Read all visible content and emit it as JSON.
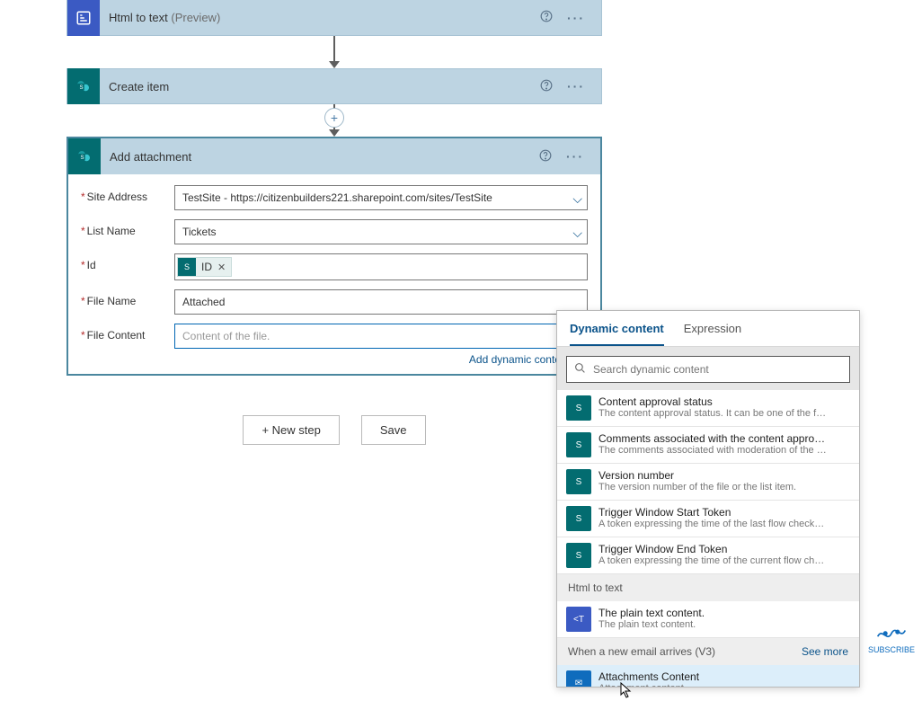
{
  "actions": {
    "htmlToText": {
      "label": "Html to text",
      "suffix": "(Preview)"
    },
    "createItem": {
      "label": "Create item"
    },
    "addAttachment": {
      "label": "Add attachment"
    }
  },
  "form": {
    "siteAddress": {
      "label": "Site Address",
      "value": "TestSite - https://citizenbuilders221.sharepoint.com/sites/TestSite"
    },
    "listName": {
      "label": "List Name",
      "value": "Tickets"
    },
    "id": {
      "label": "Id",
      "tokenLabel": "ID"
    },
    "fileName": {
      "label": "File Name",
      "value": "Attached"
    },
    "fileContent": {
      "label": "File Content",
      "placeholder": "Content of the file."
    },
    "addDynamic": "Add dynamic content"
  },
  "buttons": {
    "newStep": "+ New step",
    "save": "Save"
  },
  "popup": {
    "tabs": {
      "dynamic": "Dynamic content",
      "expression": "Expression"
    },
    "searchPlaceholder": "Search dynamic content",
    "groups": {
      "htmlToText": "Html to text",
      "emailV3": "When a new email arrives (V3)",
      "seeMore": "See more"
    },
    "items": [
      {
        "icon": "sp",
        "title": "Content approval status",
        "sub": "The content approval status. It can be one of the followin..."
      },
      {
        "icon": "sp",
        "title": "Comments associated with the content approval of this ...",
        "sub": "The comments associated with moderation of the list item."
      },
      {
        "icon": "sp",
        "title": "Version number",
        "sub": "The version number of the file or the list item."
      },
      {
        "icon": "sp",
        "title": "Trigger Window Start Token",
        "sub": "A token expressing the time of the last flow check. Use th..."
      },
      {
        "icon": "sp",
        "title": "Trigger Window End Token",
        "sub": "A token expressing the time of the current flow check. Us..."
      }
    ],
    "htmlItem": {
      "title": "The plain text content.",
      "sub": "The plain text content."
    },
    "attachItem": {
      "title": "Attachments Content",
      "sub": "Attachment content"
    }
  },
  "subscribe": "SUBSCRIBE"
}
